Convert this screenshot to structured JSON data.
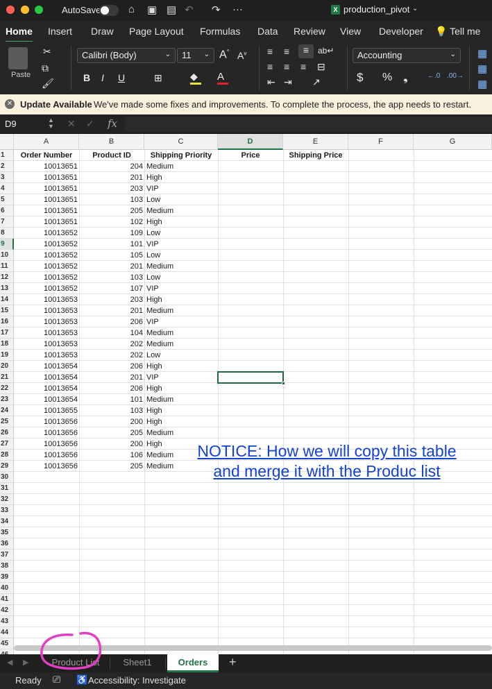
{
  "window": {
    "autosave_label": "AutoSave",
    "doc_title": "production_pivot"
  },
  "ribbon_tabs": [
    "Home",
    "Insert",
    "Draw",
    "Page Layout",
    "Formulas",
    "Data",
    "Review",
    "View",
    "Developer",
    "Tell me"
  ],
  "ribbon": {
    "paste_label": "Paste",
    "font_name": "Calibri (Body)",
    "font_size": "11",
    "number_format": "Accounting"
  },
  "notification": {
    "title": "Update Available",
    "message": "We've made some fixes and improvements. To complete the process, the app needs to restart."
  },
  "formula_bar": {
    "name_box": "D9",
    "formula": ""
  },
  "columns": [
    "A",
    "B",
    "C",
    "D",
    "E",
    "F",
    "G"
  ],
  "selected_col": "D",
  "selected_row": 9,
  "header_row": [
    "Order Number",
    "Product ID",
    "Shipping Priority",
    "Price",
    "Shipping Price"
  ],
  "rows": [
    [
      "10013651",
      "204",
      "Medium"
    ],
    [
      "10013651",
      "201",
      "High"
    ],
    [
      "10013651",
      "203",
      "VIP"
    ],
    [
      "10013651",
      "103",
      "Low"
    ],
    [
      "10013651",
      "205",
      "Medium"
    ],
    [
      "10013651",
      "102",
      "High"
    ],
    [
      "10013652",
      "109",
      "Low"
    ],
    [
      "10013652",
      "101",
      "VIP"
    ],
    [
      "10013652",
      "105",
      "Low"
    ],
    [
      "10013652",
      "201",
      "Medium"
    ],
    [
      "10013652",
      "103",
      "Low"
    ],
    [
      "10013652",
      "107",
      "VIP"
    ],
    [
      "10013653",
      "203",
      "High"
    ],
    [
      "10013653",
      "201",
      "Medium"
    ],
    [
      "10013653",
      "206",
      "VIP"
    ],
    [
      "10013653",
      "104",
      "Medium"
    ],
    [
      "10013653",
      "202",
      "Medium"
    ],
    [
      "10013653",
      "202",
      "Low"
    ],
    [
      "10013654",
      "206",
      "High"
    ],
    [
      "10013654",
      "201",
      "VIP"
    ],
    [
      "10013654",
      "206",
      "High"
    ],
    [
      "10013654",
      "101",
      "Medium"
    ],
    [
      "10013655",
      "103",
      "High"
    ],
    [
      "10013656",
      "200",
      "High"
    ],
    [
      "10013656",
      "205",
      "Medium"
    ],
    [
      "10013656",
      "200",
      "High"
    ],
    [
      "10013656",
      "106",
      "Medium"
    ],
    [
      "10013656",
      "205",
      "Medium"
    ]
  ],
  "row_count": 47,
  "notice": {
    "line1": "NOTICE: How we will copy this table",
    "line2": "and merge it with the Produc list"
  },
  "sheet_tabs": [
    "Product List",
    "Sheet1",
    "Orders"
  ],
  "active_sheet": "Orders",
  "status": {
    "ready": "Ready",
    "accessibility": "Accessibility: Investigate"
  },
  "colors": {
    "accent": "#217346",
    "annotation": "#e23fc3",
    "notice": "#1342d6"
  }
}
